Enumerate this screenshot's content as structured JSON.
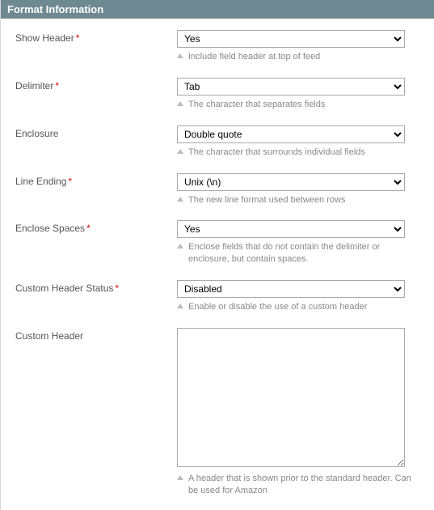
{
  "panel": {
    "title": "Format Information"
  },
  "fields": {
    "showHeader": {
      "label": "Show Header",
      "required": true,
      "value": "Yes",
      "help": "Include field header at top of feed"
    },
    "delimiter": {
      "label": "Delimiter",
      "required": true,
      "value": "Tab",
      "help": "The character that separates fields"
    },
    "enclosure": {
      "label": "Enclosure",
      "required": false,
      "value": "Double quote",
      "help": "The character that surrounds individual fields"
    },
    "lineEnding": {
      "label": "Line Ending",
      "required": true,
      "value": "Unix (\\n)",
      "help": "The new line format used between rows"
    },
    "encloseSpaces": {
      "label": "Enclose Spaces",
      "required": true,
      "value": "Yes",
      "help": "Enclose fields that do not contain the delimiter or enclosure, but contain spaces."
    },
    "customStatus": {
      "label": "Custom Header Status",
      "required": true,
      "value": "Disabled",
      "help": "Enable or disable the use of a custom header"
    },
    "customHeader": {
      "label": "Custom Header",
      "required": false,
      "value": "",
      "help": "A header that is shown prior to the standard header. Can be used for Amazon"
    }
  },
  "requiredMark": "*"
}
